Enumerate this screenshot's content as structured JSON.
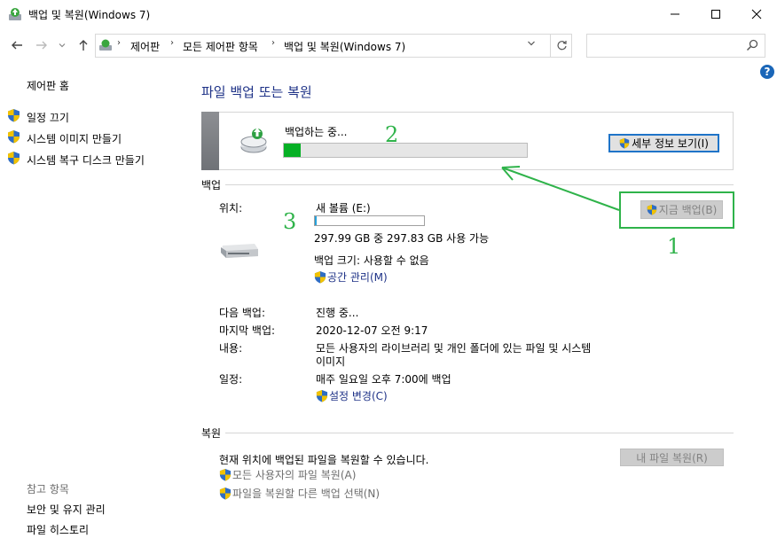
{
  "window": {
    "title": "백업 및 복원(Windows 7)"
  },
  "address_bar": {
    "breadcrumbs": [
      "제어판",
      "모든 제어판 항목",
      "백업 및 복원(Windows 7)"
    ]
  },
  "sidebar": {
    "home": "제어판 홈",
    "items": [
      {
        "label": "일정 끄기",
        "icon": "uac-shield-icon"
      },
      {
        "label": "시스템 이미지 만들기",
        "icon": "uac-shield-icon"
      },
      {
        "label": "시스템 복구 디스크 만들기",
        "icon": "uac-shield-icon"
      }
    ],
    "see_also_heading": "참고 항목",
    "see_also": [
      "보안 및 유지 관리",
      "파일 히스토리"
    ]
  },
  "main": {
    "title": "파일 백업 또는 복원",
    "progress_panel": {
      "label": "백업하는 중...",
      "progress": 0.07,
      "details_button": "세부 정보 보기(I)"
    },
    "backup_section": {
      "heading": "백업",
      "location_label": "위치:",
      "location_value": "새 볼륨 (E:)",
      "drive_usage_fraction": 0.01,
      "free_space": "297.99 GB 중 297.83 GB 사용 가능",
      "backup_size": "백업 크기: 사용할 수 없음",
      "manage_space_link": "공간 관리(M)",
      "backup_now_button": "지금 백업(B)",
      "next_backup_label": "다음 백업:",
      "next_backup_value": "진행 중...",
      "last_backup_label": "마지막 백업:",
      "last_backup_value": "2020-12-07 오전 9:17",
      "contents_label": "내용:",
      "contents_value_line1": "모든 사용자의 라이브러리 및 개인 폴더에 있는 파일 및 시스템",
      "contents_value_line2": "이미지",
      "schedule_label": "일정:",
      "schedule_value": "매주 일요일 오후 7:00에 백업",
      "change_settings_link": "설정 변경(C)"
    },
    "restore_section": {
      "heading": "복원",
      "description": "현재 위치에 백업된 파일을 복원할 수 있습니다.",
      "restore_my_files_button": "내 파일 복원(R)",
      "restore_all_users_link": "모든 사용자의 파일 복원(A)",
      "select_other_backup_link": "파일을 복원할 다른 백업 선택(N)"
    }
  },
  "annotations": {
    "marker_1": "1",
    "marker_2": "2",
    "marker_3": "3",
    "color": "#2fb34a"
  }
}
